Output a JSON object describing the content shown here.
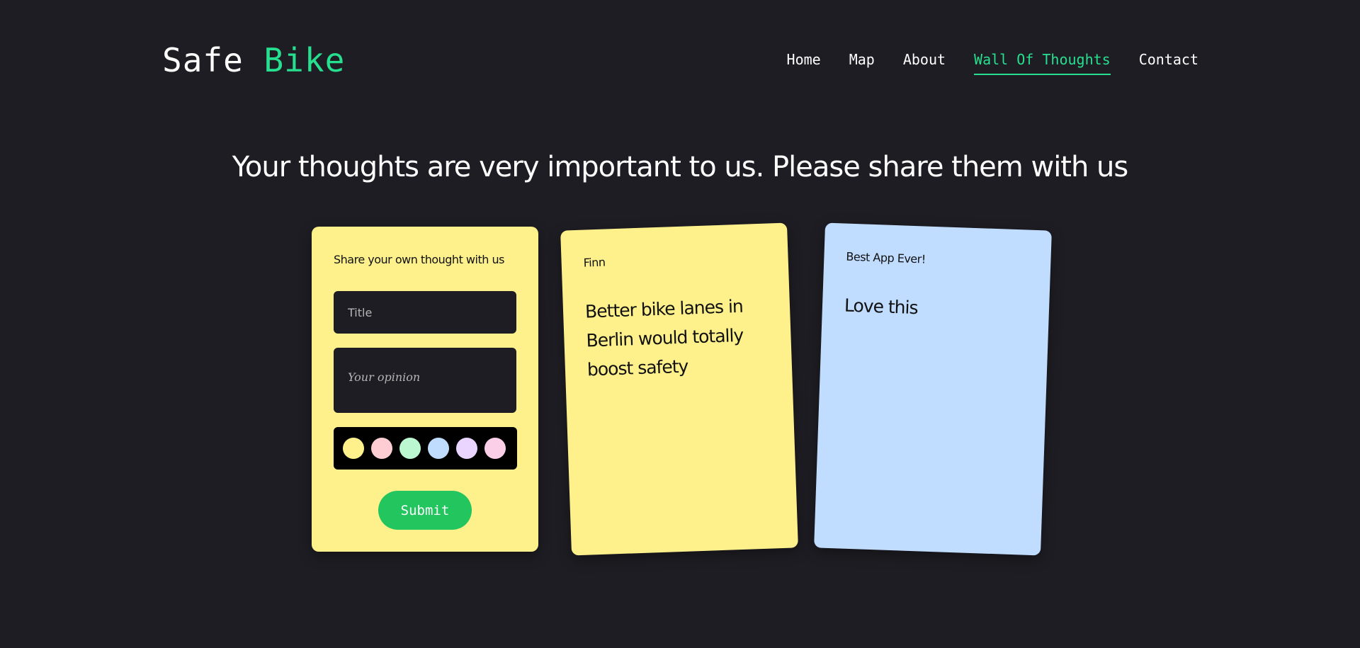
{
  "brand": {
    "word1": "Safe",
    "word2": "Bike",
    "accent_color": "#26e08f"
  },
  "nav": {
    "items": [
      {
        "label": "Home",
        "active": false
      },
      {
        "label": "Map",
        "active": false
      },
      {
        "label": "About",
        "active": false
      },
      {
        "label": "Wall Of Thoughts",
        "active": true
      },
      {
        "label": "Contact",
        "active": false
      }
    ]
  },
  "heading": "Your thoughts are very important to us. Please share them with us",
  "form": {
    "title": "Share your own thought with us",
    "title_placeholder": "Title",
    "opinion_placeholder": "Your opinion",
    "colors": [
      "#fef18c",
      "#fecdd3",
      "#bbf7d0",
      "#bfdbfe",
      "#e9d5ff",
      "#fbcfe8"
    ],
    "submit_label": "Submit"
  },
  "notes": [
    {
      "title": "Finn",
      "body": "Better bike lanes in Berlin would totally boost safety",
      "color": "#fef18c"
    },
    {
      "title": "Best App Ever!",
      "body": "Love this",
      "color": "#c0dcfe"
    }
  ]
}
